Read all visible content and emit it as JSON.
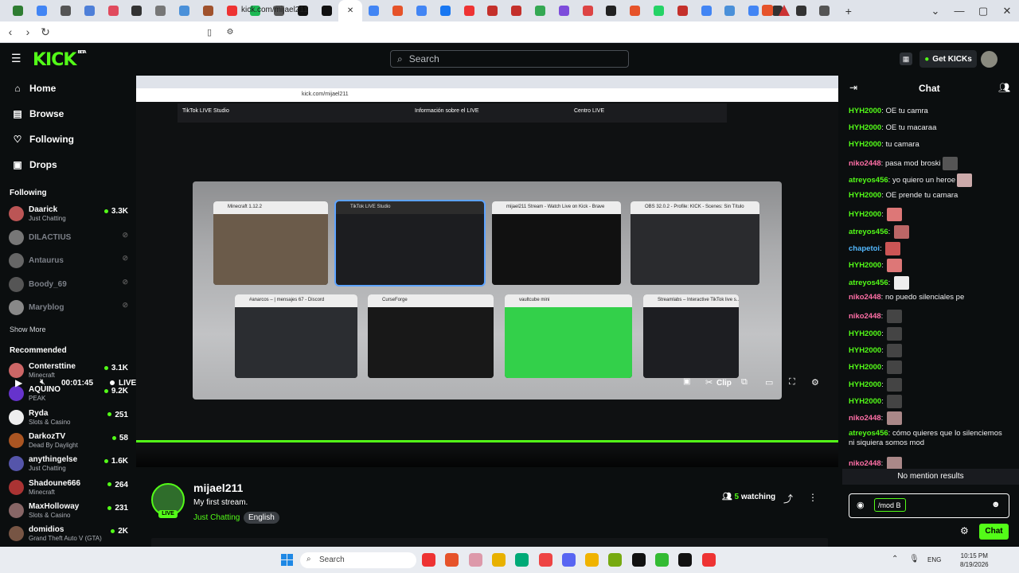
{
  "browser": {
    "url": "kick.com/mijael211",
    "tab_colors": [
      "#2f7d32",
      "#4285f4",
      "#555",
      "#4e7fd8",
      "#e04a5d",
      "#333",
      "#777",
      "#4a90d9",
      "#a0522d",
      "#e33",
      "#1db954",
      "#555",
      "#111",
      "#111",
      "#fff",
      "#4285f4",
      "#e6532a",
      "#4285f4",
      "#1877f2",
      "#e33",
      "#c4302b",
      "#c4302b",
      "#34a853",
      "#7d4cdb",
      "#d44",
      "#222",
      "#e6532a",
      "#25d366",
      "#c4302b",
      "#4285f4",
      "#4a90d9",
      "#4285f4",
      "#333",
      "#333",
      "#555"
    ]
  },
  "header": {
    "logo": "KICK",
    "logo_badge": "BETA",
    "search_placeholder": "Search",
    "get_kicks": "Get KICKs"
  },
  "sidebar": {
    "nav": [
      {
        "label": "Home",
        "icon": "home-icon",
        "glyph": "⌂"
      },
      {
        "label": "Browse",
        "icon": "browse-icon",
        "glyph": "▤"
      },
      {
        "label": "Following",
        "icon": "heart-icon",
        "glyph": "♡"
      },
      {
        "label": "Drops",
        "icon": "drops-icon",
        "glyph": "▣"
      }
    ],
    "following_title": "Following",
    "following": [
      {
        "name": "Daarick",
        "category": "Just Chatting",
        "viewers": "3.3K",
        "online": true,
        "color": "#b55"
      },
      {
        "name": "DILACTIUS",
        "category": "",
        "viewers": "⊘",
        "online": false,
        "color": "#777"
      },
      {
        "name": "Antaurus",
        "category": "",
        "viewers": "⊘",
        "online": false,
        "color": "#666"
      },
      {
        "name": "Boody_69",
        "category": "",
        "viewers": "⊘",
        "online": false,
        "color": "#555"
      },
      {
        "name": "Maryblog",
        "category": "",
        "viewers": "⊘",
        "online": false,
        "color": "#888"
      }
    ],
    "show_more_1": "Show More",
    "recommended_title": "Recommended",
    "recommended": [
      {
        "name": "Contersttine",
        "category": "Minecraft",
        "viewers": "3.1K",
        "color": "#c66"
      },
      {
        "name": "AQUINO",
        "category": "PEAK",
        "viewers": "9.2K",
        "color": "#63c"
      },
      {
        "name": "Ryda",
        "category": "Slots & Casino",
        "viewers": "251",
        "color": "#eee"
      },
      {
        "name": "DarkozTV",
        "category": "Dead By Daylight",
        "viewers": "58",
        "color": "#a52"
      },
      {
        "name": "anythingelse",
        "category": "Just Chatting",
        "viewers": "1.6K",
        "color": "#55a"
      },
      {
        "name": "Shadoune666",
        "category": "Minecraft",
        "viewers": "264",
        "color": "#a33"
      },
      {
        "name": "MaxHolloway",
        "category": "Slots & Casino",
        "viewers": "231",
        "color": "#866"
      },
      {
        "name": "domidios",
        "category": "Grand Theft Auto V (GTA)",
        "viewers": "2K",
        "color": "#754"
      }
    ]
  },
  "video": {
    "inner_url": "kick.com/mijael211",
    "app_title": "TikTok LIVE Studio",
    "app_center": "Información sobre el LIVE",
    "app_right": "Centro LIVE",
    "windows_row1": [
      {
        "title": "Minecraft 1.12.2",
        "dark": false,
        "color": "#6b5b4a"
      },
      {
        "title": "TikTok LIVE Studio",
        "dark": true,
        "color": "#1c1d20"
      },
      {
        "title": "mijael211 Stream - Watch Live on Kick - Brave",
        "dark": false,
        "color": "#111"
      },
      {
        "title": "OBS 32.0.2 - Profile: KICK - Scenes: Sin Título",
        "dark": false,
        "color": "#2a2b2e"
      }
    ],
    "windows_row2": [
      {
        "title": "#anarcos – | mensajes 67 - Discord",
        "dark": false,
        "color": "#2b2d31"
      },
      {
        "title": "CurseForge",
        "dark": false,
        "color": "#181818"
      },
      {
        "title": "vaultcube mini",
        "dark": false,
        "color": "#33d04a"
      },
      {
        "title": "Streamlabs – Interactive TikTok live s...",
        "dark": false,
        "color": "#1d1e22"
      }
    ],
    "time": "00:01:45",
    "live_label": "LIVE",
    "clip_label": "Clip"
  },
  "stream": {
    "name": "mijael211",
    "title": "My first stream.",
    "category": "Just Chatting",
    "language": "English",
    "live_badge": "LIVE",
    "watching_count": "5",
    "watching_label": "watching"
  },
  "chat": {
    "title": "Chat",
    "messages": [
      {
        "user": "HYH2000",
        "color": "#53fc18",
        "text": "OE tu camra",
        "emote": null
      },
      {
        "user": "HYH2000",
        "color": "#53fc18",
        "text": "OE tu macaraa",
        "emote": null
      },
      {
        "user": "HYH2000",
        "color": "#53fc18",
        "text": "tu camara",
        "emote": null
      },
      {
        "user": "niko2448",
        "color": "#ff6fa6",
        "text": "pasa mod broski",
        "emote": "#555"
      },
      {
        "user": "atreyos456",
        "color": "#53fc18",
        "text": "yo quiero un heroe",
        "emote": "#caa"
      },
      {
        "user": "HYH2000",
        "color": "#53fc18",
        "text": "OE prende tu camara",
        "emote": null
      },
      {
        "user": "HYH2000",
        "color": "#53fc18",
        "text": "",
        "emote": "#d77"
      },
      {
        "user": "atreyos456",
        "color": "#53fc18",
        "text": "",
        "emote": "#b66"
      },
      {
        "user": "chapetoi",
        "color": "#53b9ff",
        "text": "",
        "emote": "#c55"
      },
      {
        "user": "HYH2000",
        "color": "#53fc18",
        "text": "",
        "emote": "#d77"
      },
      {
        "user": "atreyos456",
        "color": "#53fc18",
        "text": "",
        "emote": "#eee"
      },
      {
        "user": "niko2448",
        "color": "#ff6fa6",
        "text": "no puedo silenciales pe",
        "emote": null
      },
      {
        "user": "niko2448",
        "color": "#ff6fa6",
        "text": "",
        "emote": "#444"
      },
      {
        "user": "HYH2000",
        "color": "#53fc18",
        "text": "",
        "emote": "#444"
      },
      {
        "user": "HYH2000",
        "color": "#53fc18",
        "text": "",
        "emote": "#444"
      },
      {
        "user": "HYH2000",
        "color": "#53fc18",
        "text": "",
        "emote": "#444"
      },
      {
        "user": "HYH2000",
        "color": "#53fc18",
        "text": "",
        "emote": "#444"
      },
      {
        "user": "HYH2000",
        "color": "#53fc18",
        "text": "",
        "emote": "#444"
      },
      {
        "user": "niko2448",
        "color": "#ff6fa6",
        "text": "",
        "emote": "#a88"
      },
      {
        "user": "atreyos456",
        "color": "#53fc18",
        "text": "cómo quieres que lo silenciemos ni siquiera somos mod",
        "emote": null
      },
      {
        "user": "niko2448",
        "color": "#ff6fa6",
        "text": "",
        "emote": "#a88"
      }
    ],
    "no_mention": "No mention results",
    "input_value": "/mod B",
    "send_label": "Chat"
  },
  "taskbar": {
    "search": "Search",
    "lang": "ENG",
    "time": "10:15 PM",
    "date": "8/19/2026",
    "icon_colors": [
      "#e33",
      "#e6532a",
      "#d9a",
      "#e8b100",
      "#0a7",
      "#e44",
      "#5865f2",
      "#f0b300",
      "#7a1",
      "#111",
      "#3b3",
      "#111",
      "#e33"
    ]
  }
}
